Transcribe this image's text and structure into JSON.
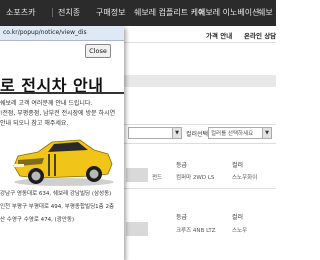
{
  "top_nav": {
    "item1": "소포츠카",
    "item2": "전치종",
    "item3": "구매정보",
    "item4": "쉐보레 컴플리트 케어",
    "item5": "쉐보레 이노베이션",
    "item6": "쉐보"
  },
  "sub_nav": {
    "item1": "가격 안내",
    "item2": "온라인 상담"
  },
  "filters": {
    "label1": "컬러선택",
    "placeholder2": "컬러를 선택하세요"
  },
  "table": {
    "col_grade": "등급",
    "col_color": "컬러",
    "rows": [
      {
        "name": "펀드",
        "grade": "컴퍼마 2WD LS",
        "color": "스노우화이"
      },
      {
        "name": "",
        "grade": "크루즈 4NB LTZ",
        "color": "스노우"
      }
    ]
  },
  "popup": {
    "url": "co.kr/popup/notice/view_dis",
    "close_label": "Close",
    "title": "로 전시차 안내",
    "lines": [
      "쉐보레 고객 여러분께 안내 드립니다.",
      "!전점, 부평종점, 남부전 전시장에 방문 하시연",
      "안내 되오니 참고 해주세요."
    ],
    "addresses": [
      "강남구 영동대로 634, 쉐보레 강남빌딩 (삼성동)",
      "인천 부평구 부평대로 494, 부평종합빌딩1층 2층",
      "산 수영구 수영로 474, (광안동)"
    ],
    "car_color": "#f0c419"
  }
}
